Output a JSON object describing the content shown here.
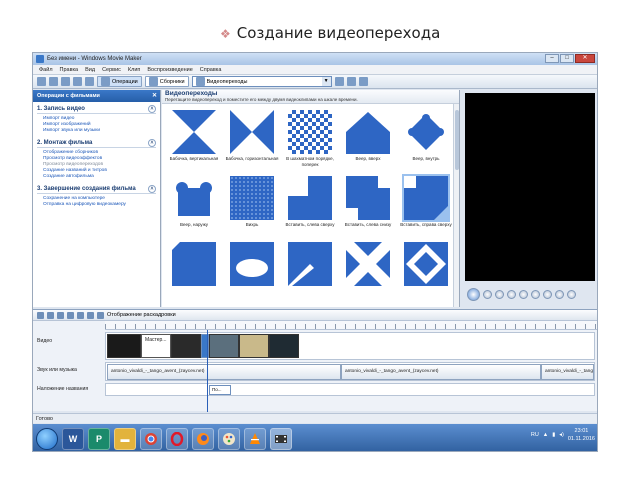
{
  "slide": {
    "title": "Создание видеоперехода",
    "bullet": "❖"
  },
  "window": {
    "title": "Без имени - Windows Movie Maker",
    "controls": [
      "–",
      "□",
      "✕"
    ]
  },
  "menu": [
    "Файл",
    "Правка",
    "Вид",
    "Сервис",
    "Клип",
    "Воспроизведение",
    "Справка"
  ],
  "toolbar": {
    "operations": "Операции",
    "collections": "Сборники",
    "current_collection": "Видеопереходы"
  },
  "tasks": {
    "header": "Операции с фильмами",
    "sections": [
      {
        "title": "1. Запись видео",
        "links": [
          "Импорт видео",
          "Импорт изображений",
          "Импорт звука или музыки"
        ]
      },
      {
        "title": "2. Монтаж фильма",
        "links": [
          "Отображение сборников",
          "Просмотр видеоэффектов",
          "Просмотр видеопереходов",
          "Создание названий и титров",
          "Создание автофильма"
        ]
      },
      {
        "title": "3. Завершение создания фильма",
        "links": [
          "Сохранение на компьютере",
          "Отправка на цифровую видеокамеру"
        ]
      }
    ]
  },
  "collection": {
    "title": "Видеопереходы",
    "description": "Перетащите видеопереход и поместите его между двумя видеоклипами на шкале времени.",
    "items": [
      {
        "label": "Бабочка, вертикальная",
        "icon": "butterfly-vertical-icon"
      },
      {
        "label": "Бабочка, горизонтальная",
        "icon": "butterfly-horizontal-icon"
      },
      {
        "label": "В шахматном порядке, поперек",
        "icon": "checkerboard-icon"
      },
      {
        "label": "Веер, вверх",
        "icon": "fan-up-icon"
      },
      {
        "label": "Веер, внутрь",
        "icon": "fan-in-icon"
      },
      {
        "label": "Веер, наружу",
        "icon": "fan-out-icon"
      },
      {
        "label": "Вихрь",
        "icon": "whirlwind-icon"
      },
      {
        "label": "Вставить, слева сверху",
        "icon": "inset-top-left-icon"
      },
      {
        "label": "Вставить, слева снизу",
        "icon": "inset-bottom-left-icon"
      },
      {
        "label": "Вставить, справа сверху",
        "icon": "inset-top-right-icon"
      },
      {
        "label": "",
        "icon": "corner-diagonal-icon"
      },
      {
        "label": "",
        "icon": "eye-shape-icon"
      },
      {
        "label": "",
        "icon": "diagonal-wipe-icon"
      },
      {
        "label": "",
        "icon": "diamond-cross-icon"
      },
      {
        "label": "",
        "icon": "diamond-cross-icon"
      }
    ]
  },
  "storyboard": {
    "toggle_label": "Отображение раскадровки",
    "tracks": {
      "video": "Видео",
      "audio": "Звук или музыка",
      "overlay": "Наложение названия"
    },
    "video_clip_label": "Мастер...",
    "audio_clips": [
      "antonio_vivaldi_-_tango_avent_(zaycev.net)",
      "antonio_vivaldi_-_tango_avent_(zaycev.net)",
      "antonio_vivaldi_-_tango_av"
    ],
    "overlay_clip": "По..."
  },
  "status": {
    "text": "Готово"
  },
  "taskbar": {
    "apps": [
      "word-icon",
      "publisher-icon",
      "explorer-folder-icon",
      "chrome-icon",
      "opera-icon",
      "firefox-icon",
      "paint-icon",
      "vlc-icon",
      "movie-maker-icon"
    ],
    "lang": "RU",
    "time": "23:01",
    "date": "01.11.2016"
  }
}
